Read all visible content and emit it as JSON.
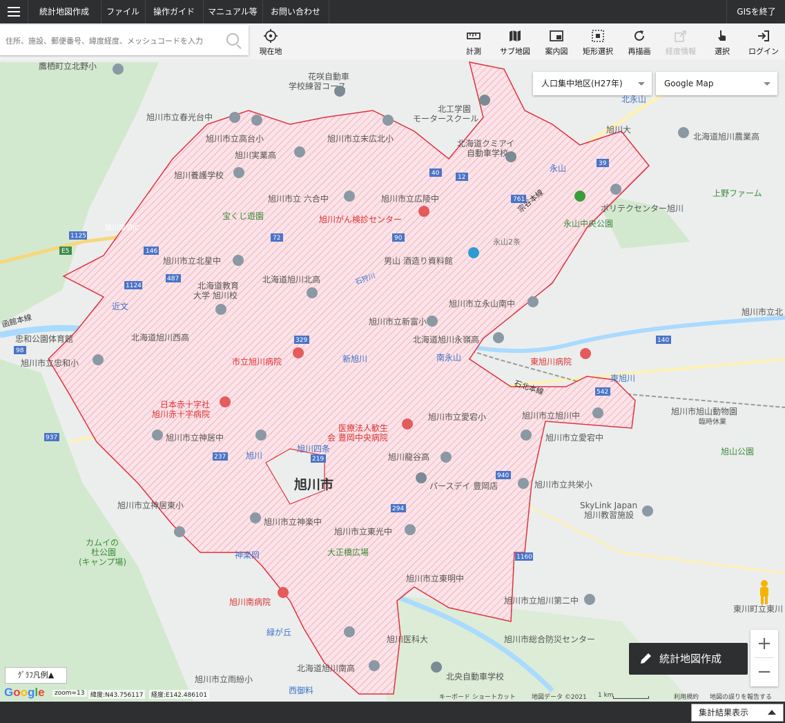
{
  "top_menu": {
    "items": [
      "統計地図作成",
      "ファイル",
      "操作ガイド",
      "マニュアル等",
      "お問い合わせ"
    ],
    "exit": "GISを終了"
  },
  "search": {
    "placeholder": "住所、施設、郵便番号、緯度経度、メッシュコードを入力"
  },
  "tools": {
    "current_location": "現在地",
    "measure": "計測",
    "sub_map": "サブ地図",
    "guide_map": "案内図",
    "rect_select": "矩形選択",
    "redraw": "再描画",
    "disabled_tool": "経度情報",
    "select": "選択",
    "login": "ログイン"
  },
  "layer_select": {
    "value": "人口集中地区(H27年)"
  },
  "basemap_select": {
    "value": "Google Map"
  },
  "map": {
    "city_label": "旭川市",
    "labels": [
      "鷹栖町立北野小",
      "花咲自動車",
      "学校練習コース",
      "旭川市立春光台中",
      "旭川市立高台小",
      "旭川実業高",
      "旭川市立末広北小",
      "北工学園",
      "モータースクール",
      "北海道クミアイ",
      "自動車学校",
      "旭川大",
      "北海道旭川農業高",
      "旭川養護学校",
      "北永山",
      "永山",
      "旭川市立 六合中",
      "旭川市立広陵中",
      "宝くじ遊園",
      "旭川がん検診センター",
      "上野ファーム",
      "ポリテクセンター旭川",
      "永山中央公園",
      "旭川市立北星中",
      "男山 酒造り資料館",
      "北海道教育",
      "大学 旭川校",
      "北海道旭川北高",
      "旭川市立永山南中",
      "旭川市立新富小",
      "近文",
      "北海道旭川西高",
      "北海道旭川永嶺高",
      "忠和公園体育館",
      "旭川市立忠和小",
      "市立旭川病院",
      "新旭川",
      "南永山",
      "東旭川病院",
      "東旭川",
      "石北本線",
      "日本赤十字社",
      "旭川赤十字病院",
      "医療法人歓生",
      "会 豊岡中央病院",
      "旭川市立愛宕小",
      "旭川市立旭川中",
      "旭川市旭山動物園",
      "臨時休業",
      "旭川市立神居中",
      "旭川四条",
      "旭川",
      "旭川市立愛宕中",
      "旭川龍谷高",
      "旭山公園",
      "パースデイ 豊岡店",
      "旭川市立共栄小",
      "SkyLink Japan",
      "旭川教習施設",
      "旭川市立神居東小",
      "旭川市立神楽中",
      "カムイの",
      "杜公園",
      "(キャンプ場)",
      "旭川市立東光中",
      "神楽岡",
      "大正橋広場",
      "旭川市立東明中",
      "旭川南病院",
      "旭川市立旭川第二中",
      "緑が丘",
      "旭川医科大",
      "旭川市総合防災センター",
      "東川町立東川",
      "旭川市立雨紛小",
      "北海道旭川南高",
      "北央自動車学校",
      "西御料",
      "函館本線",
      "宗谷本線",
      "石狩川",
      "旭川鷹栖IC",
      "永山2条",
      "旭川市立北"
    ],
    "road_numbers": [
      "E5",
      "1125",
      "146",
      "12",
      "40",
      "90",
      "761",
      "72",
      "39",
      "487",
      "1124",
      "329",
      "140",
      "542",
      "219",
      "937",
      "237",
      "294",
      "940",
      "1160",
      "98"
    ]
  },
  "legend_button": "ｸﾞﾗﾌ凡例▲",
  "google_logo": "Google",
  "status": {
    "zoom": "zoom=13",
    "lat": "緯度:N43.756117",
    "lng": "経度:E142.486101"
  },
  "attribution": {
    "shortcuts": "キーボード ショートカット",
    "data": "地図データ ©2021",
    "scale": "1 km",
    "terms": "利用規約",
    "report": "地図の誤りを報告する"
  },
  "make_map_button": "統計地図作成",
  "zoom": {
    "in": "+",
    "out": "−"
  },
  "result_button": "集計結果表示"
}
